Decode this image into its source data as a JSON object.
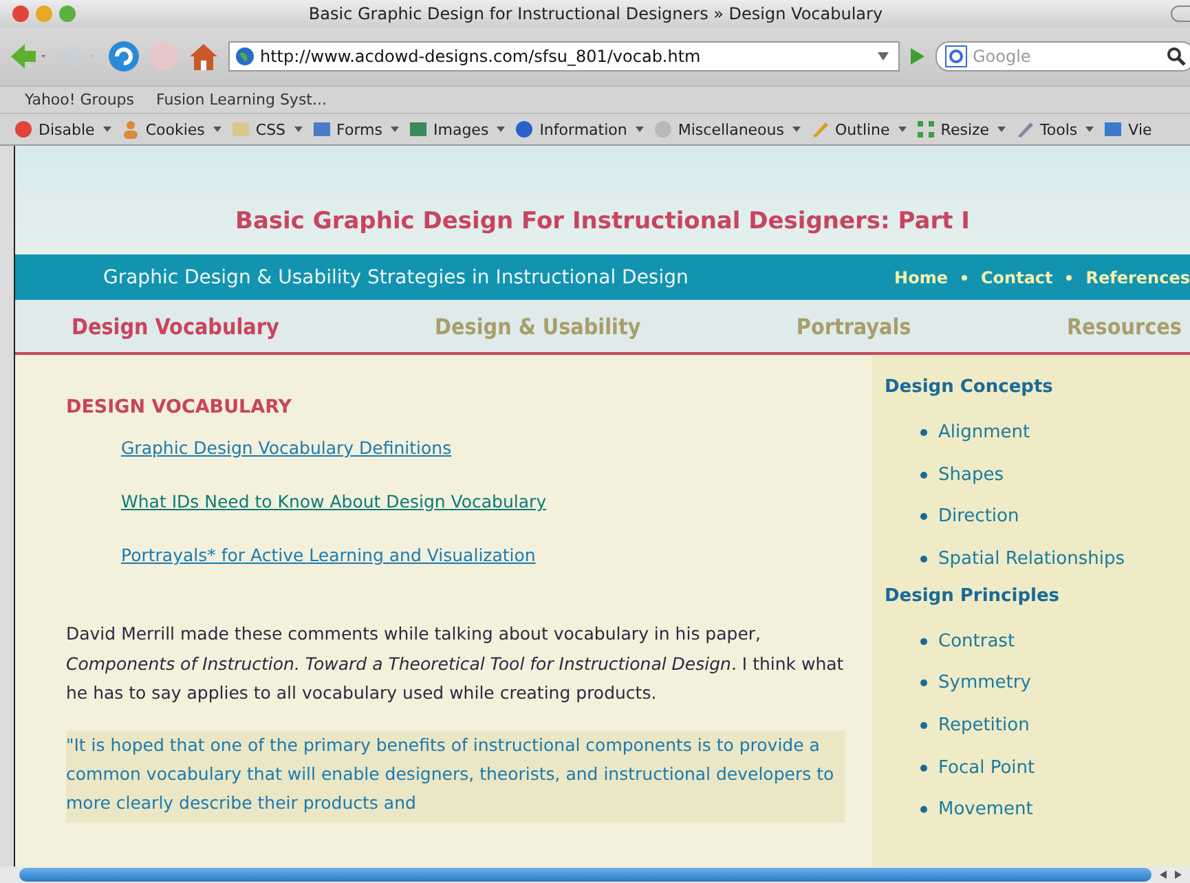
{
  "window": {
    "title": "Basic Graphic Design for Instructional Designers » Design Vocabulary"
  },
  "address_bar": {
    "value": "http://www.acdowd-designs.com/sfsu_801/vocab.htm"
  },
  "search": {
    "placeholder": "Google"
  },
  "bookmarks": [
    "Yahoo! Groups",
    "Fusion Learning Syst..."
  ],
  "dev_toolbar": [
    {
      "label": "Disable",
      "kind": "disable"
    },
    {
      "label": "Cookies",
      "kind": "cookies"
    },
    {
      "label": "CSS",
      "kind": "css"
    },
    {
      "label": "Forms",
      "kind": "forms"
    },
    {
      "label": "Images",
      "kind": "images"
    },
    {
      "label": "Information",
      "kind": "info"
    },
    {
      "label": "Miscellaneous",
      "kind": "misc"
    },
    {
      "label": "Outline",
      "kind": "outline"
    },
    {
      "label": "Resize",
      "kind": "resize"
    },
    {
      "label": "Tools",
      "kind": "tools"
    },
    {
      "label": "Vie",
      "kind": "view"
    }
  ],
  "page": {
    "site_title": "Basic Graphic Design For Instructional Designers: Part I",
    "tagline": "Graphic Design & Usability Strategies in Instructional Design",
    "header_links": [
      "Home",
      "Contact",
      "References"
    ],
    "nav": [
      {
        "label": "Design Vocabulary",
        "selected": true
      },
      {
        "label": "Design & Usability",
        "selected": false
      },
      {
        "label": "Portrayals",
        "selected": false
      },
      {
        "label": "Resources",
        "selected": false
      }
    ],
    "heading": "DESIGN VOCABULARY",
    "links": [
      "Graphic Design Vocabulary Definitions",
      "What IDs Need to Know About Design Vocabulary",
      "Portrayals* for Active Learning and Visualization"
    ],
    "paragraph": "David Merrill made these comments while talking about vocabulary in his paper, *Components of Instruction. Toward a Theoretical Tool for Instructional Design*. I think what he has to say applies to all vocabulary used while creating products.",
    "quote": "\"It is hoped that one of the primary benefits of instructional components is to provide a common vocabulary that will enable designers, theorists, and instructional developers to more clearly describe their products and",
    "sidebar": [
      {
        "title": "Design Concepts",
        "items": [
          "Alignment",
          "Shapes",
          "Direction",
          "Spatial Relationships"
        ]
      },
      {
        "title": "Design Principles",
        "items": [
          "Contrast",
          "Symmetry",
          "Repetition",
          "Focal Point",
          "Movement"
        ]
      }
    ]
  }
}
